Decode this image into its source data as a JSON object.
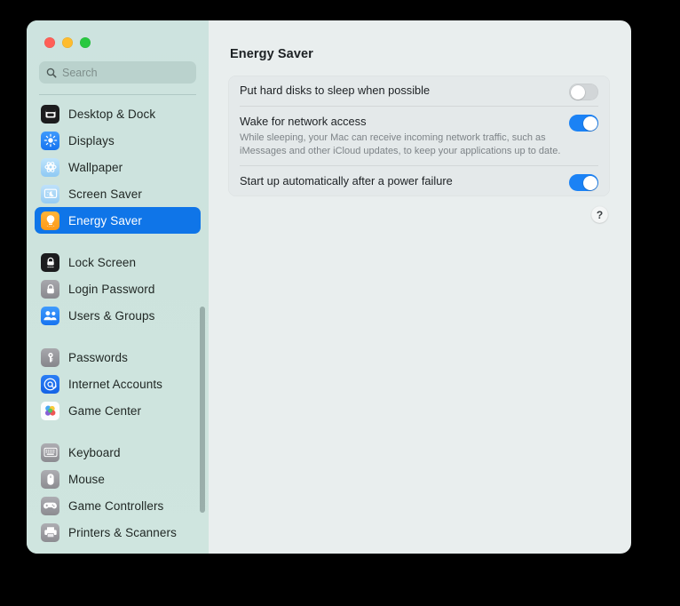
{
  "window": {
    "traffic_lights": [
      {
        "name": "close",
        "label": "Close",
        "color": "#ff5f57"
      },
      {
        "name": "minimize",
        "label": "Minimize",
        "color": "#febc2e"
      },
      {
        "name": "maximize",
        "label": "Maximize",
        "color": "#28c840"
      }
    ]
  },
  "search": {
    "placeholder": "Search",
    "value": "",
    "icon": "search-icon"
  },
  "sidebar": {
    "selected": "Energy Saver",
    "accent_color": "#0f75e8",
    "background_color": "#cde3de",
    "groups": [
      {
        "items": [
          {
            "label": "Desktop & Dock",
            "icon": "desktop-and-dock-icon",
            "icon_class": "ic-desktop"
          },
          {
            "label": "Displays",
            "icon": "displays-icon",
            "icon_class": "ic-displays"
          },
          {
            "label": "Wallpaper",
            "icon": "wallpaper-icon",
            "icon_class": "ic-wallpaper"
          },
          {
            "label": "Screen Saver",
            "icon": "screen-saver-icon",
            "icon_class": "ic-screensaver"
          },
          {
            "label": "Energy Saver",
            "icon": "energy-saver-icon",
            "icon_class": "ic-energy",
            "selected": true
          }
        ]
      },
      {
        "items": [
          {
            "label": "Lock Screen",
            "icon": "lock-screen-icon",
            "icon_class": "ic-lock"
          },
          {
            "label": "Login Password",
            "icon": "login-password-icon",
            "icon_class": "ic-loginpw"
          },
          {
            "label": "Users & Groups",
            "icon": "users-and-groups-icon",
            "icon_class": "ic-users"
          }
        ]
      },
      {
        "items": [
          {
            "label": "Passwords",
            "icon": "passwords-key-icon",
            "icon_class": "ic-passwords"
          },
          {
            "label": "Internet Accounts",
            "icon": "internet-accounts-at-icon",
            "icon_class": "ic-internet"
          },
          {
            "label": "Game Center",
            "icon": "game-center-icon",
            "icon_class": "ic-gamecenter"
          }
        ]
      },
      {
        "items": [
          {
            "label": "Keyboard",
            "icon": "keyboard-icon",
            "icon_class": "ic-keyboard"
          },
          {
            "label": "Mouse",
            "icon": "mouse-icon",
            "icon_class": "ic-mouse"
          },
          {
            "label": "Game Controllers",
            "icon": "game-controller-icon",
            "icon_class": "ic-gamepad"
          },
          {
            "label": "Printers & Scanners",
            "icon": "printer-icon",
            "icon_class": "ic-printers"
          }
        ]
      }
    ],
    "scrollbar": {
      "visible": true
    }
  },
  "main": {
    "title": "Energy Saver",
    "background_color": "#e9eeee",
    "settings": [
      {
        "title": "Put hard disks to sleep when possible",
        "description": "",
        "toggle": {
          "state": "off",
          "label": "Off"
        }
      },
      {
        "title": "Wake for network access",
        "description": "While sleeping, your Mac can receive incoming network traffic, such as iMessages and other iCloud updates, to keep your applications up to date.",
        "toggle": {
          "state": "on",
          "label": "On"
        }
      },
      {
        "title": "Start up automatically after a power failure",
        "description": "",
        "toggle": {
          "state": "on",
          "label": "On"
        }
      }
    ],
    "help": {
      "label": "?",
      "icon": "question-mark-icon"
    }
  }
}
